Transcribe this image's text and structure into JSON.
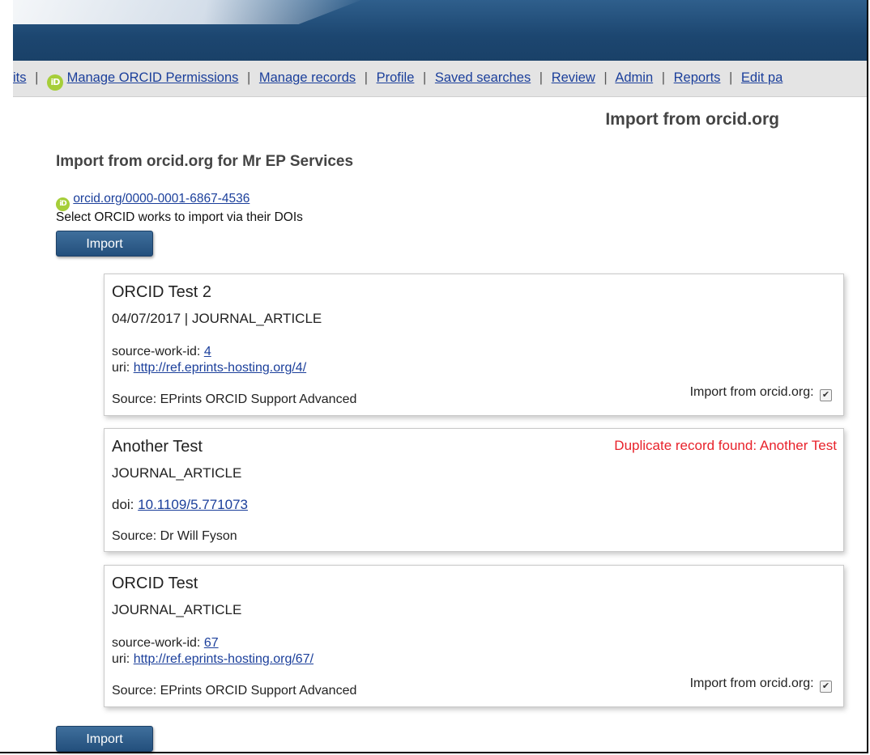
{
  "menu": {
    "cut_label": "its",
    "items": [
      {
        "label": "Manage ORCID Permissions",
        "icon": "orcid-icon"
      },
      {
        "label": "Manage records"
      },
      {
        "label": "Profile"
      },
      {
        "label": "Saved searches"
      },
      {
        "label": "Review"
      },
      {
        "label": "Admin"
      },
      {
        "label": "Reports"
      },
      {
        "label": "Edit pa"
      }
    ],
    "separator": "|"
  },
  "page": {
    "title": "Import from orcid.org",
    "heading": "Import from orcid.org for Mr EP Services",
    "orcid_link": "orcid.org/0000-0001-6867-4536",
    "help_text": "Select ORCID works to import via their DOIs",
    "import_label": "Import"
  },
  "orcid_icon_text": "iD",
  "orcid_icon_color": "#a6ce39",
  "works": [
    {
      "title": "ORCID Test 2",
      "meta": "04/07/2017 | JOURNAL_ARTICLE",
      "field1_label": "source-work-id:",
      "field1_value": "4",
      "field2_label": "uri:",
      "field2_value": "http://ref.eprints-hosting.org/4/",
      "source": "Source: EPrints ORCID Support Advanced",
      "import_label": "Import from orcid.org:",
      "checked": true
    },
    {
      "title": "Another Test",
      "meta": "JOURNAL_ARTICLE",
      "field1_label": "doi:",
      "field1_value": "10.1109/5.771073",
      "source": "Source: Dr Will Fyson",
      "duplicate": "Duplicate record found: Another Test"
    },
    {
      "title": "ORCID Test",
      "meta": "JOURNAL_ARTICLE",
      "field1_label": "source-work-id:",
      "field1_value": "67",
      "field2_label": "uri:",
      "field2_value": "http://ref.eprints-hosting.org/67/",
      "source": "Source: EPrints ORCID Support Advanced",
      "import_label": "Import from orcid.org:",
      "checked": true
    }
  ],
  "colors": {
    "header": "#1c4670",
    "link": "#1b3f9b",
    "duplicate": "#e8222b",
    "button": "#2d5a87"
  }
}
